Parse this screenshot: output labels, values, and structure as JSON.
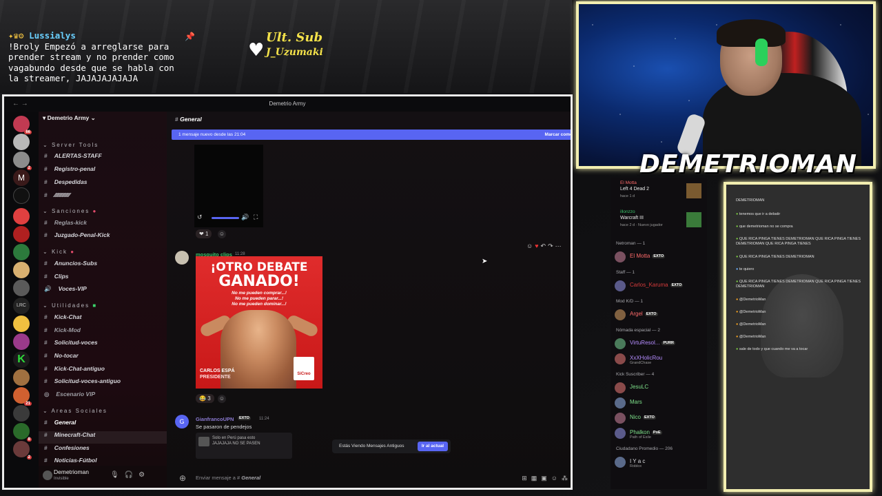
{
  "overlay": {
    "chat_user": "Lussialys",
    "chat_message": "!Broly Empezó a arreglarse para prender stream y no prender como vagabundo desde que se habla con la streamer, JAJAJAJAJAJA",
    "ult_sub_title": "Ult. Sub",
    "ult_sub_name": "J_Uzumaki",
    "caster_name": "DEMETRIOMAN"
  },
  "window": {
    "title": "Demetrio Army"
  },
  "server": {
    "name": "Demetrio Army"
  },
  "categories": {
    "server_tools": "Server Tools",
    "sanciones": "Sanciones",
    "kick": "Kick",
    "utilidades": "Utilidades",
    "areas_sociales": "Areas Sociales"
  },
  "channels": [
    {
      "name": "ALERTAS-STAFF"
    },
    {
      "name": "Registro-penal"
    },
    {
      "name": "Despedidas"
    },
    {
      "name": "Reglas-kick"
    },
    {
      "name": "Juzgado-Penal-Kick"
    },
    {
      "name": "Anuncios-Subs"
    },
    {
      "name": "Clips"
    },
    {
      "name": "Voces-VIP"
    },
    {
      "name": "Kick-Chat"
    },
    {
      "name": "Kick-Mod"
    },
    {
      "name": "Solicitud-voces"
    },
    {
      "name": "No-tocar"
    },
    {
      "name": "Kick-Chat-antiguo"
    },
    {
      "name": "Solicitud-voces-antiguo"
    },
    {
      "name": "Escenario VIP"
    },
    {
      "name": "General"
    },
    {
      "name": "Minecraft-Chat"
    },
    {
      "name": "Confesiones"
    },
    {
      "name": "Noticias-Fútbol"
    }
  ],
  "user_panel": {
    "name": "Demetrioman",
    "status": "Invisible"
  },
  "chat": {
    "channel": "General",
    "new_messages_banner": "1 mensaje nuevo desde las 21:04",
    "mark_read": "Marcar como",
    "reaction_1": "1",
    "msg1_author": "mosquito clips",
    "msg1_time": "11:28",
    "poster_line1": "¡OTRO DEBATE",
    "poster_line2": "GANADO!",
    "poster_sub1": "No me pueden comprar...!",
    "poster_sub2": "No me pueden parar...!",
    "poster_sub3": "No me pueden dominar...!",
    "poster_name": "CARLOS ESPÁ",
    "poster_role": "PRESIDENTE",
    "poster_logo": "SíCreo",
    "reaction_2": "3",
    "msg2_author": "GianfrancoUPN",
    "msg2_tag": "EXTO",
    "msg2_time": "11:24",
    "msg2_text": "Se pasaron de pendejos",
    "embed_title": "Solo en Perú pasa esto",
    "embed_text": "JAJAJAJA NO SE PASEN",
    "toast_text": "Estás Viendo Mensajes Antiguos",
    "toast_button": "Ir al actual",
    "input_placeholder": "Enviar mensaje a #",
    "input_channel": "General"
  },
  "members": {
    "activity": [
      {
        "name": "El Motta",
        "game": "Left 4 Dead 2",
        "sub": "hace 1 d"
      },
      {
        "name": "illonzzo",
        "game": "Warcraft III",
        "sub": "hace 2 d · Nuevo jugador"
      }
    ],
    "groups": [
      {
        "title": "Netroman — 1",
        "members": [
          {
            "name": "El Motta",
            "tag": "EXTO",
            "color": "#ff6b6b"
          }
        ]
      },
      {
        "title": "Staff — 1",
        "members": [
          {
            "name": "Carlos_Karuma",
            "tag": "EXTO",
            "color": "#d63b3b"
          }
        ]
      },
      {
        "title": "Mod K/D — 1",
        "members": [
          {
            "name": "Argel",
            "tag": "EXTO",
            "color": "#ff6b6b"
          }
        ]
      },
      {
        "title": "Nómada espacial — 2",
        "members": [
          {
            "name": "VirtuResol...",
            "tag": "PURR",
            "color": "#b58cff"
          },
          {
            "name": "XxXHolicRou",
            "sub": "GrandChase",
            "color": "#b58cff"
          }
        ]
      },
      {
        "title": "Kick Suscriber — 4",
        "members": [
          {
            "name": "JesuLC",
            "color": "#7ee08a"
          },
          {
            "name": "Mars",
            "color": "#7ee08a"
          },
          {
            "name": "Nico",
            "tag": "EXTO",
            "color": "#7ee08a"
          },
          {
            "name": "Phalkon",
            "tag": "PoE",
            "sub": "Path of Exile",
            "color": "#7ee08a"
          }
        ]
      },
      {
        "title": "Ciudadano Promedio — 206",
        "members": [
          {
            "name": "I Y a c",
            "sub": "Roblox",
            "color": "#dcdde0"
          }
        ]
      }
    ]
  },
  "right_chat": {
    "header": "DEMETRIOMAN",
    "lines": [
      "tenemos que ir a debatir",
      "que demetrioman no se compra",
      "QUE RICA PINGA TIENES DEMETRIOMAN QUE RICA PINGA TIENES DEMETRIOMAN QUE RICA PINGA TIENES",
      "QUE RICA PINGA TIENES DEMETRIOMAN",
      "te quiero",
      "QUE RICA PINGA TIENES DEMETRIOMAN QUE RICA PINGA TIENES DEMETRIOMAN",
      "@DemetrioMan",
      "@DemetrioMan",
      "@DemetrioMan",
      "@DemetrioMan",
      "sale de todo y que cuando me va a tocar"
    ]
  },
  "colors": {
    "accent": "#5865f2",
    "frame": "#f2eeb0",
    "poster": "#e02c2c"
  }
}
